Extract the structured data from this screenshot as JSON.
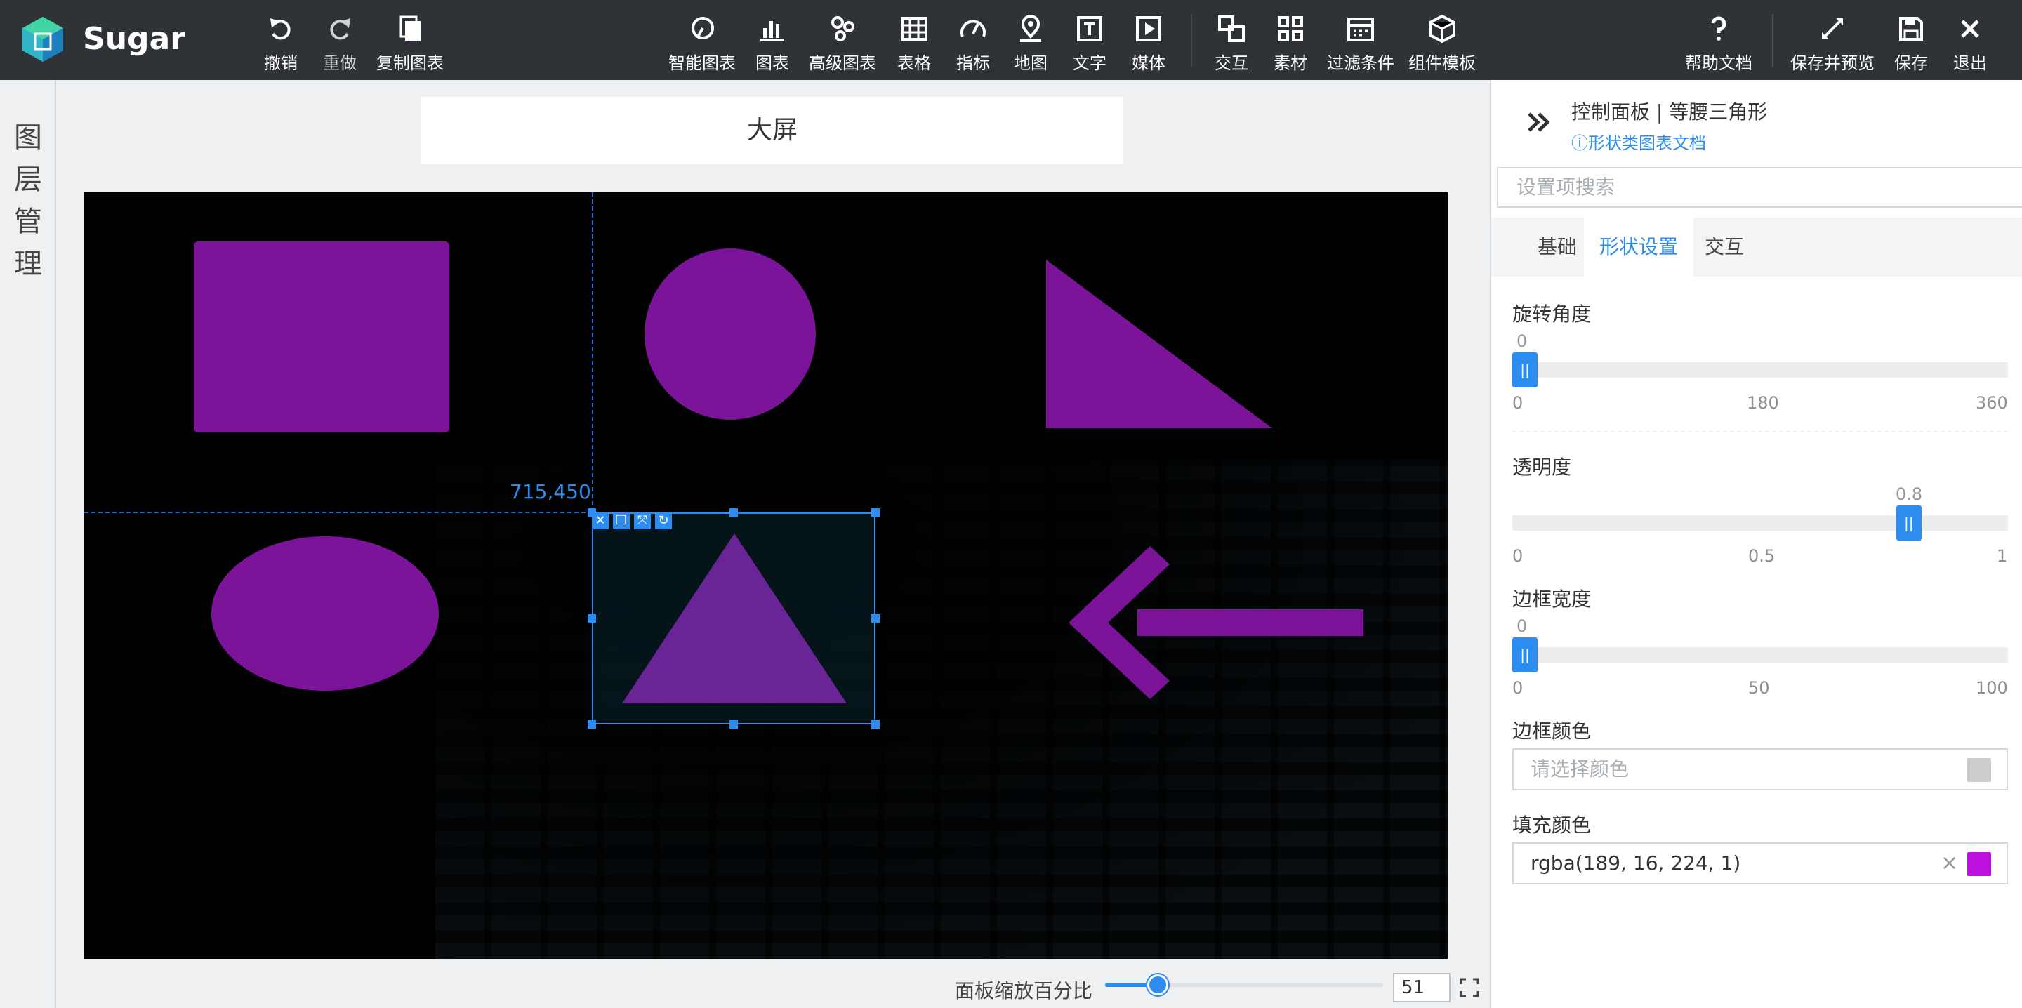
{
  "app": {
    "name": "Sugar"
  },
  "toolbar": {
    "left": [
      {
        "label": "撤销",
        "icon": "undo-icon"
      },
      {
        "label": "重做",
        "icon": "redo-icon"
      },
      {
        "label": "复制图表",
        "icon": "copy-icon"
      }
    ],
    "center": [
      {
        "label": "智能图表",
        "icon": "smart-chart-icon"
      },
      {
        "label": "图表",
        "icon": "bar-chart-icon"
      },
      {
        "label": "高级图表",
        "icon": "advanced-chart-icon"
      },
      {
        "label": "表格",
        "icon": "table-icon"
      },
      {
        "label": "指标",
        "icon": "gauge-icon"
      },
      {
        "label": "地图",
        "icon": "map-pin-icon"
      },
      {
        "label": "文字",
        "icon": "text-icon"
      },
      {
        "label": "媒体",
        "icon": "media-icon"
      },
      {
        "label": "交互",
        "icon": "interaction-icon"
      },
      {
        "label": "素材",
        "icon": "material-icon"
      },
      {
        "label": "过滤条件",
        "icon": "filter-icon"
      },
      {
        "label": "组件模板",
        "icon": "template-icon"
      }
    ],
    "right": [
      {
        "label": "帮助文档",
        "icon": "help-icon"
      },
      {
        "label": "保存并预览",
        "icon": "expand-icon"
      },
      {
        "label": "保存",
        "icon": "save-icon"
      },
      {
        "label": "退出",
        "icon": "close-icon"
      }
    ]
  },
  "left_rail": {
    "label": "图层管理"
  },
  "canvas": {
    "title": "大屏",
    "coord_readout": "715,450",
    "fill_color": "#7b1499",
    "zoom_label": "面板缩放百分比",
    "zoom_value": "51",
    "zoom_fraction": 0.19
  },
  "panel": {
    "title": "控制面板 | 等腰三角形",
    "doc_link": "ⓘ形状类图表文档",
    "search_placeholder": "设置项搜索",
    "tabs": [
      "基础",
      "形状设置",
      "交互"
    ],
    "active_tab": 1,
    "rotation": {
      "label": "旋转角度",
      "value": "0",
      "fraction": 0,
      "ticks": [
        "0",
        "180",
        "360"
      ]
    },
    "opacity": {
      "label": "透明度",
      "value": "0.8",
      "fraction": 0.8,
      "ticks": [
        "0",
        "0.5",
        "1"
      ]
    },
    "border_width": {
      "label": "边框宽度",
      "value": "0",
      "fraction": 0,
      "ticks": [
        "0",
        "50",
        "100"
      ]
    },
    "border_color": {
      "label": "边框颜色",
      "placeholder": "请选择颜色",
      "swatch": "#cccccc"
    },
    "fill_color": {
      "label": "填充颜色",
      "value": "rgba(189, 16, 224, 1)",
      "swatch": "#bd10e0",
      "clear": "×"
    }
  }
}
